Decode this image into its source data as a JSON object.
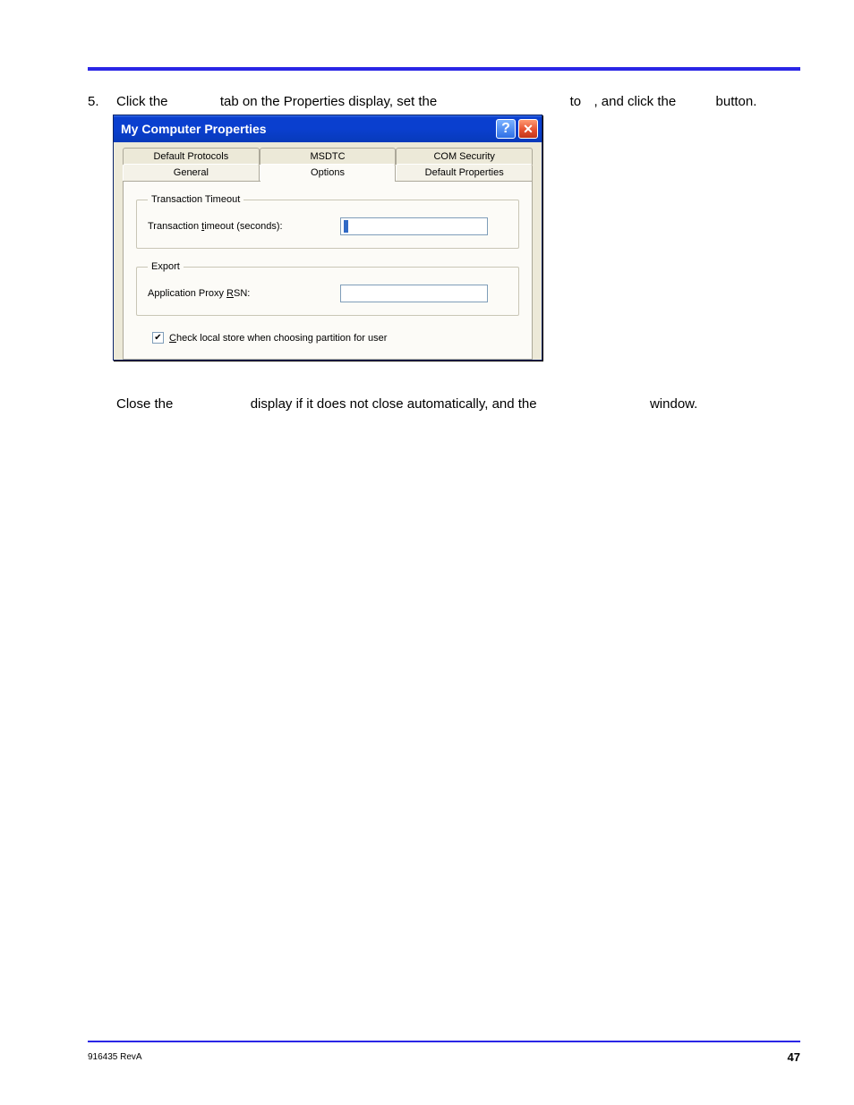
{
  "step": {
    "number": "5.",
    "line_parts": {
      "p1": "Click the",
      "p2": "tab on the Properties display, set the",
      "p3": "to",
      "p4": ", and click the",
      "p5": "button."
    }
  },
  "dialog": {
    "title": "My Computer Properties",
    "help_glyph": "?",
    "close_glyph": "✕",
    "tabs_back": [
      "Default Protocols",
      "MSDTC",
      "COM Security"
    ],
    "tabs_front": [
      "General",
      "Options",
      "Default Properties"
    ],
    "selected_front_index": 1,
    "group_timeout": {
      "legend": "Transaction Timeout",
      "label_prefix": "Transaction ",
      "label_ul": "t",
      "label_suffix": "imeout (seconds):",
      "value": ""
    },
    "group_export": {
      "legend": "Export",
      "label_prefix": "Application Proxy ",
      "label_ul": "R",
      "label_suffix": "SN:",
      "value": ""
    },
    "checkbox": {
      "checked_glyph": "✔",
      "label_ul": "C",
      "label_suffix": "heck local store when choosing partition for user"
    }
  },
  "under_dialog": {
    "p1": "Close the",
    "p2": "display if it does not close automatically, and the",
    "p3": "window."
  },
  "footer": {
    "doc_id": "916435 RevA",
    "page": "47"
  }
}
